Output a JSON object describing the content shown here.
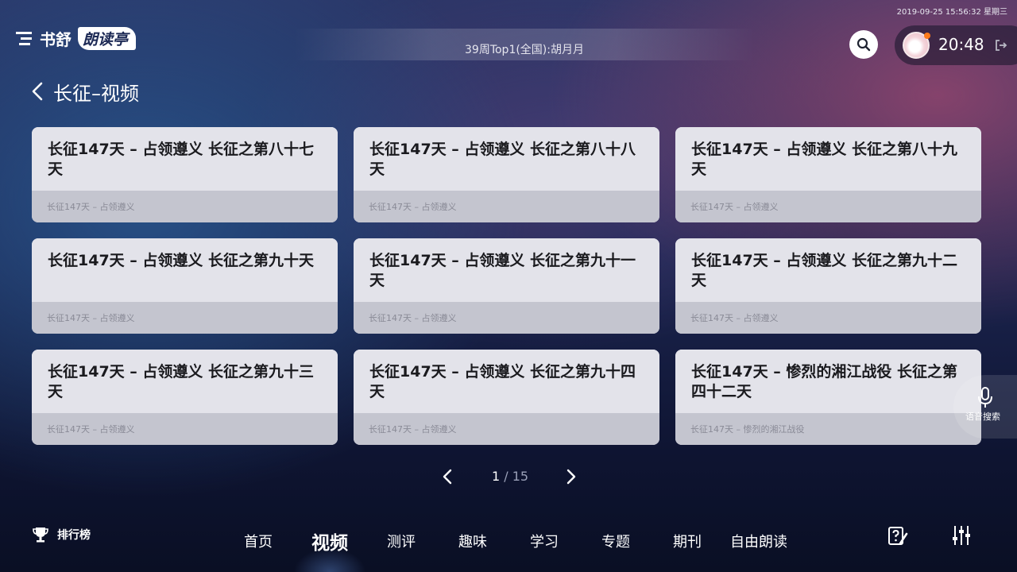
{
  "status": {
    "datetime": "2019-09-25 15:56:32 星期三"
  },
  "header": {
    "logo_text": "书舒",
    "logo_brand": "朗读亭",
    "marquee": "39周Top1(全国):胡月月",
    "clock": "20:48"
  },
  "page": {
    "title": "长征–视频"
  },
  "cards": [
    {
      "title": "长征147天 – 占领遵义 长征之第八十七天",
      "subtitle": "长征147天 – 占领遵义"
    },
    {
      "title": "长征147天 – 占领遵义 长征之第八十八天",
      "subtitle": "长征147天 – 占领遵义"
    },
    {
      "title": "长征147天 – 占领遵义 长征之第八十九天",
      "subtitle": "长征147天 – 占领遵义"
    },
    {
      "title": "长征147天 – 占领遵义 长征之第九十天",
      "subtitle": "长征147天 – 占领遵义"
    },
    {
      "title": "长征147天 – 占领遵义 长征之第九十一天",
      "subtitle": "长征147天 – 占领遵义"
    },
    {
      "title": "长征147天 – 占领遵义 长征之第九十二天",
      "subtitle": "长征147天 – 占领遵义"
    },
    {
      "title": "长征147天 – 占领遵义 长征之第九十三天",
      "subtitle": "长征147天 – 占领遵义"
    },
    {
      "title": "长征147天 – 占领遵义 长征之第九十四天",
      "subtitle": "长征147天 – 占领遵义"
    },
    {
      "title": "长征147天 – 惨烈的湘江战役 长征之第四十二天",
      "subtitle": "长征147天 – 惨烈的湘江战役"
    }
  ],
  "pager": {
    "current": "1",
    "separator": "/",
    "total": "15"
  },
  "voice": {
    "label": "语音搜索"
  },
  "bottom": {
    "rank_label": "排行榜",
    "nav": [
      "首页",
      "视频",
      "测评",
      "趣味",
      "学习",
      "专题",
      "期刊",
      "自由朗读"
    ],
    "active_index": 1
  },
  "icons": {
    "logo": "book-logo-icon",
    "search": "search-icon",
    "logout": "logout-icon",
    "back": "chevron-left-icon",
    "voice": "microphone-icon",
    "rank": "trophy-icon",
    "quiz": "quiz-pencil-icon",
    "settings": "sliders-icon"
  },
  "colors": {
    "accent_dot": "#ff7a1a",
    "card_bg": "#e3e3ea",
    "card_footer": "#c4c5cf"
  }
}
